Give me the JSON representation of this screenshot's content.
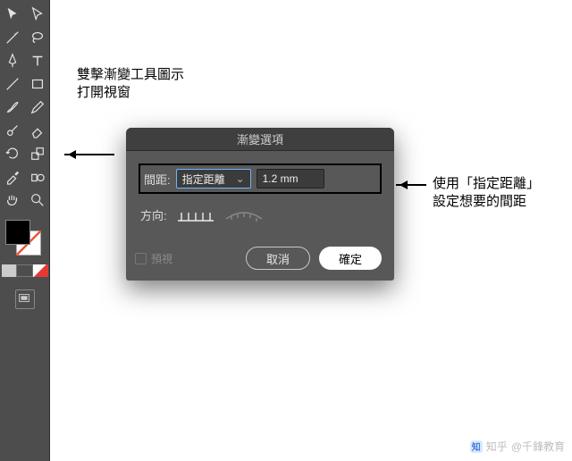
{
  "annotations": {
    "top_line1": "雙擊漸變工具圖示",
    "top_line2": "打開視窗",
    "right_line1": "使用「指定距離」",
    "right_line2": "設定想要的間距"
  },
  "dialog": {
    "title": "漸變選項",
    "spacing_label": "間距:",
    "spacing_mode": "指定距離",
    "spacing_value": "1.2 mm",
    "direction_label": "方向:",
    "preview_label": "預視",
    "cancel": "取消",
    "confirm": "確定"
  },
  "toolbar": {
    "tools": [
      [
        "selection",
        "direct-select"
      ],
      [
        "pen",
        "type"
      ],
      [
        "line",
        "shape"
      ],
      [
        "brush",
        "eraser"
      ],
      [
        "rotate",
        "scale"
      ],
      [
        "width",
        "warp"
      ],
      [
        "mesh",
        "gradient"
      ],
      [
        "eyedropper",
        "blend"
      ],
      [
        "symbol",
        "graph"
      ],
      [
        "artboard",
        "slice"
      ],
      [
        "hand",
        "zoom"
      ]
    ],
    "color_row": [
      "#cccccc",
      "#4d4d4d",
      "#e74c3c"
    ]
  },
  "watermark": {
    "site": "知乎",
    "author": "@千鋒教育"
  }
}
